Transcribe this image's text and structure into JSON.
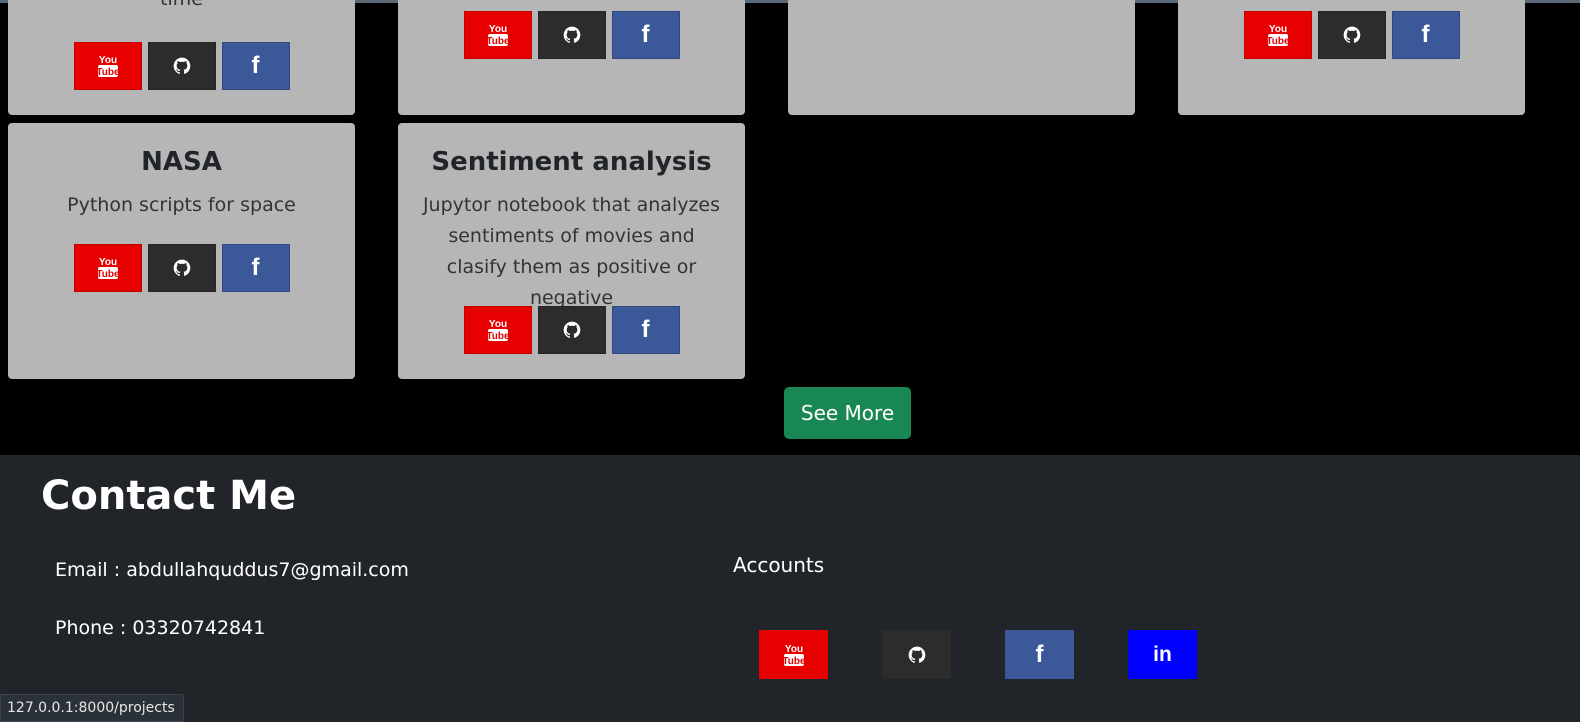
{
  "cards": [
    {
      "text": "time"
    },
    {},
    {},
    {},
    {
      "title": "NASA",
      "text": "Python scripts for space"
    },
    {
      "title": "Sentiment analysis",
      "text": "Jupytor notebook that analyzes sentiments of movies and clasify them as positive or negative"
    }
  ],
  "see_more_label": "See More",
  "contact": {
    "title": "Contact Me",
    "email": "Email : abdullahquddus7@gmail.com",
    "phone": "Phone : 03320742841",
    "accounts_label": "Accounts"
  },
  "icons": {
    "youtube": "youtube-icon",
    "github": "github-icon",
    "facebook": "facebook-icon",
    "linkedin": "linkedin-icon"
  },
  "colors": {
    "youtube": "#e60000",
    "github": "#2c2c2c",
    "facebook": "#3b5898",
    "linkedin": "#0000ff",
    "see_more": "#198754",
    "card": "#b6b6b6",
    "footer": "#212529"
  },
  "status_url": "127.0.0.1:8000/projects"
}
